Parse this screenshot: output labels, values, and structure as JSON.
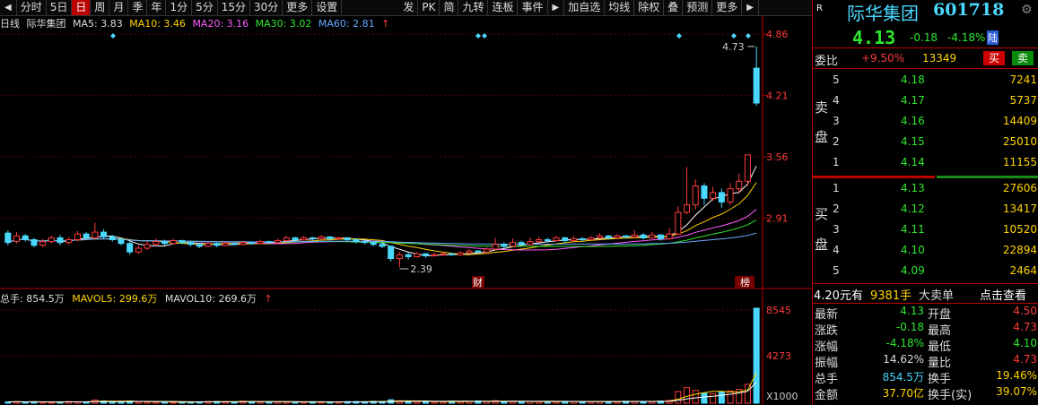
{
  "toolbar": {
    "left_arrow": "◀",
    "tabs": [
      "分时",
      "5日",
      "日",
      "周",
      "月",
      "季",
      "年",
      "1分",
      "5分",
      "15分",
      "30分",
      "更多",
      "设置"
    ],
    "active_tab": 2,
    "right_tabs": [
      "发",
      "PK",
      "简",
      "九转",
      "连板",
      "事件",
      "▶",
      "加自选",
      "均线",
      "除权",
      "叠",
      "预测",
      "更多",
      "▶"
    ]
  },
  "legend": {
    "period": "日线",
    "name": "际华集团",
    "ma5": "MA5: 3.83",
    "ma10": "MA10: 3.46",
    "ma20": "MA20: 3.16",
    "ma30": "MA30: 3.02",
    "ma60": "MA60: 2.81",
    "up_arrow": "↑"
  },
  "price_axis": [
    "4.86",
    "4.21",
    "3.56",
    "2.91"
  ],
  "annotations": {
    "high": "4.73",
    "low": "2.39",
    "marker_cai": "财",
    "marker_bang": "榜"
  },
  "vol_legend": {
    "total": "总手: 854.5万",
    "mavol5": "MAVOL5: 299.6万",
    "mavol10": "MAVOL10: 269.6万",
    "up_arrow": "↑"
  },
  "vol_axis": [
    "8545",
    "4273",
    "X1000"
  ],
  "colors": {
    "up": "#ff3b3b",
    "down": "#4ad8ff",
    "ma5": "#ffffff",
    "ma10": "#ffd400",
    "ma20": "#ff5cff",
    "ma30": "#2ee62e",
    "ma60": "#6aa8ff"
  },
  "quote": {
    "r": "R",
    "title": "际华集团",
    "code": "601718",
    "price": "4.13",
    "change": "-0.18",
    "change_pct": "-4.18%",
    "badge": "陆",
    "weibi_label": "委比",
    "weibi": "+9.50%",
    "weicha": "13349",
    "buy_btn": "买",
    "sell_btn": "卖",
    "sell_label1": "卖",
    "sell_label2": "盘",
    "buy_label1": "买",
    "buy_label2": "盘",
    "asks": [
      {
        "level": "5",
        "price": "4.18",
        "vol": "7241"
      },
      {
        "level": "4",
        "price": "4.17",
        "vol": "5737"
      },
      {
        "level": "3",
        "price": "4.16",
        "vol": "14409"
      },
      {
        "level": "2",
        "price": "4.15",
        "vol": "25010"
      },
      {
        "level": "1",
        "price": "4.14",
        "vol": "11155"
      }
    ],
    "bids": [
      {
        "level": "1",
        "price": "4.13",
        "vol": "27606"
      },
      {
        "level": "2",
        "price": "4.12",
        "vol": "13417"
      },
      {
        "level": "3",
        "price": "4.11",
        "vol": "10520"
      },
      {
        "level": "4",
        "price": "4.10",
        "vol": "22894"
      },
      {
        "level": "5",
        "price": "4.09",
        "vol": "2464"
      }
    ],
    "big_order_price": "4.20元有",
    "big_order_vol": "9381手",
    "big_order_label": "大卖单",
    "big_order_link": "点击查看",
    "stats": [
      {
        "l1": "最新",
        "v1": "4.13",
        "c1": "green",
        "l2": "开盘",
        "v2": "4.50",
        "c2": "red"
      },
      {
        "l1": "涨跌",
        "v1": "-0.18",
        "c1": "green",
        "l2": "最高",
        "v2": "4.73",
        "c2": "red"
      },
      {
        "l1": "涨幅",
        "v1": "-4.18%",
        "c1": "green",
        "l2": "最低",
        "v2": "4.10",
        "c2": "green"
      },
      {
        "l1": "振幅",
        "v1": "14.62%",
        "c1": "white",
        "l2": "量比",
        "v2": "4.73",
        "c2": "red"
      },
      {
        "l1": "总手",
        "v1": "854.5万",
        "c1": "cyan",
        "l2": "换手",
        "v2": "19.46%",
        "c2": "yellow"
      },
      {
        "l1": "金额",
        "v1": "37.70亿",
        "c1": "yellow",
        "l2": "换手(实)",
        "v2": "39.07%",
        "c2": "yellow"
      }
    ]
  },
  "chart_data": {
    "type": "candlestick",
    "ylim": [
      2.2,
      4.9
    ],
    "candles": [
      [
        2.75,
        2.65,
        2.78,
        2.62
      ],
      [
        2.66,
        2.72,
        2.76,
        2.64
      ],
      [
        2.72,
        2.68,
        2.74,
        2.66
      ],
      [
        2.68,
        2.62,
        2.7,
        2.6
      ],
      [
        2.62,
        2.66,
        2.69,
        2.6
      ],
      [
        2.66,
        2.7,
        2.72,
        2.64
      ],
      [
        2.7,
        2.65,
        2.73,
        2.62
      ],
      [
        2.65,
        2.68,
        2.71,
        2.63
      ],
      [
        2.68,
        2.74,
        2.77,
        2.66
      ],
      [
        2.74,
        2.7,
        2.76,
        2.68
      ],
      [
        2.7,
        2.76,
        2.86,
        2.68
      ],
      [
        2.76,
        2.71,
        2.79,
        2.69
      ],
      [
        2.71,
        2.68,
        2.73,
        2.66
      ],
      [
        2.68,
        2.64,
        2.7,
        2.62
      ],
      [
        2.64,
        2.55,
        2.66,
        2.52
      ],
      [
        2.55,
        2.59,
        2.62,
        2.53
      ],
      [
        2.59,
        2.63,
        2.66,
        2.57
      ],
      [
        2.63,
        2.66,
        2.69,
        2.61
      ],
      [
        2.66,
        2.64,
        2.68,
        2.62
      ],
      [
        2.64,
        2.67,
        2.69,
        2.63
      ],
      [
        2.67,
        2.65,
        2.68,
        2.63
      ],
      [
        2.65,
        2.63,
        2.66,
        2.61
      ],
      [
        2.63,
        2.61,
        2.64,
        2.59
      ],
      [
        2.61,
        2.64,
        2.66,
        2.6
      ],
      [
        2.64,
        2.62,
        2.65,
        2.6
      ],
      [
        2.62,
        2.64,
        2.66,
        2.61
      ],
      [
        2.64,
        2.63,
        2.65,
        2.62
      ],
      [
        2.63,
        2.65,
        2.67,
        2.62
      ],
      [
        2.65,
        2.64,
        2.66,
        2.63
      ],
      [
        2.64,
        2.66,
        2.68,
        2.63
      ],
      [
        2.66,
        2.65,
        2.67,
        2.64
      ],
      [
        2.65,
        2.67,
        2.69,
        2.64
      ],
      [
        2.67,
        2.7,
        2.72,
        2.66
      ],
      [
        2.7,
        2.68,
        2.71,
        2.66
      ],
      [
        2.68,
        2.7,
        2.72,
        2.67
      ],
      [
        2.7,
        2.69,
        2.71,
        2.67
      ],
      [
        2.69,
        2.71,
        2.73,
        2.68
      ],
      [
        2.71,
        2.69,
        2.72,
        2.67
      ],
      [
        2.69,
        2.7,
        2.71,
        2.68
      ],
      [
        2.7,
        2.68,
        2.71,
        2.66
      ],
      [
        2.68,
        2.66,
        2.69,
        2.64
      ],
      [
        2.66,
        2.65,
        2.67,
        2.63
      ],
      [
        2.65,
        2.63,
        2.66,
        2.61
      ],
      [
        2.63,
        2.61,
        2.64,
        2.59
      ],
      [
        2.61,
        2.48,
        2.62,
        2.45
      ],
      [
        2.48,
        2.52,
        2.55,
        2.39
      ],
      [
        2.52,
        2.5,
        2.54,
        2.47
      ],
      [
        2.5,
        2.53,
        2.55,
        2.49
      ],
      [
        2.53,
        2.51,
        2.54,
        2.49
      ],
      [
        2.51,
        2.52,
        2.54,
        2.5
      ],
      [
        2.52,
        2.53,
        2.55,
        2.51
      ],
      [
        2.53,
        2.52,
        2.54,
        2.51
      ],
      [
        2.52,
        2.54,
        2.56,
        2.51
      ],
      [
        2.54,
        2.56,
        2.58,
        2.53
      ],
      [
        2.56,
        2.55,
        2.57,
        2.54
      ],
      [
        2.55,
        2.58,
        2.6,
        2.54
      ],
      [
        2.58,
        2.63,
        2.7,
        2.57
      ],
      [
        2.63,
        2.61,
        2.65,
        2.59
      ],
      [
        2.61,
        2.65,
        2.69,
        2.6
      ],
      [
        2.65,
        2.63,
        2.67,
        2.62
      ],
      [
        2.63,
        2.66,
        2.7,
        2.62
      ],
      [
        2.66,
        2.68,
        2.71,
        2.65
      ],
      [
        2.68,
        2.67,
        2.7,
        2.65
      ],
      [
        2.67,
        2.7,
        2.72,
        2.66
      ],
      [
        2.7,
        2.67,
        2.71,
        2.65
      ],
      [
        2.67,
        2.69,
        2.72,
        2.66
      ],
      [
        2.69,
        2.68,
        2.71,
        2.66
      ],
      [
        2.68,
        2.7,
        2.72,
        2.67
      ],
      [
        2.7,
        2.72,
        2.75,
        2.69
      ],
      [
        2.72,
        2.7,
        2.73,
        2.68
      ],
      [
        2.7,
        2.72,
        2.74,
        2.69
      ],
      [
        2.72,
        2.71,
        2.73,
        2.69
      ],
      [
        2.71,
        2.73,
        2.78,
        2.7
      ],
      [
        2.73,
        2.7,
        2.75,
        2.68
      ],
      [
        2.7,
        2.73,
        2.76,
        2.69
      ],
      [
        2.73,
        2.69,
        2.74,
        2.67
      ],
      [
        2.69,
        2.74,
        2.8,
        2.68
      ],
      [
        2.74,
        2.97,
        3.03,
        2.73
      ],
      [
        2.97,
        3.05,
        3.45,
        2.95
      ],
      [
        3.05,
        3.25,
        3.32,
        3.0
      ],
      [
        3.25,
        3.12,
        3.28,
        3.05
      ],
      [
        3.12,
        3.18,
        3.24,
        3.09
      ],
      [
        3.18,
        3.08,
        3.22,
        3.02
      ],
      [
        3.08,
        3.22,
        3.28,
        3.05
      ],
      [
        3.22,
        3.3,
        3.38,
        3.18
      ],
      [
        3.3,
        3.58,
        3.58,
        3.25
      ],
      [
        4.5,
        4.13,
        4.73,
        4.1
      ]
    ],
    "volumes": [
      120,
      140,
      110,
      130,
      100,
      90,
      120,
      150,
      130,
      110,
      280,
      200,
      160,
      140,
      190,
      130,
      120,
      110,
      100,
      90,
      120,
      110,
      130,
      150,
      160,
      140,
      120,
      180,
      150,
      140,
      130,
      120,
      110,
      100,
      120,
      130,
      110,
      100,
      120,
      140,
      150,
      130,
      170,
      160,
      310,
      220,
      180,
      150,
      130,
      120,
      140,
      180,
      150,
      160,
      210,
      170,
      230,
      160,
      150,
      140,
      160,
      150,
      140,
      150,
      170,
      160,
      140,
      150,
      160,
      150,
      140,
      180,
      170,
      160,
      150,
      190,
      260,
      1050,
      1400,
      1150,
      900,
      850,
      1050,
      1100,
      1250,
      1700,
      8545
    ],
    "vol_ylim": [
      0,
      8545
    ]
  }
}
